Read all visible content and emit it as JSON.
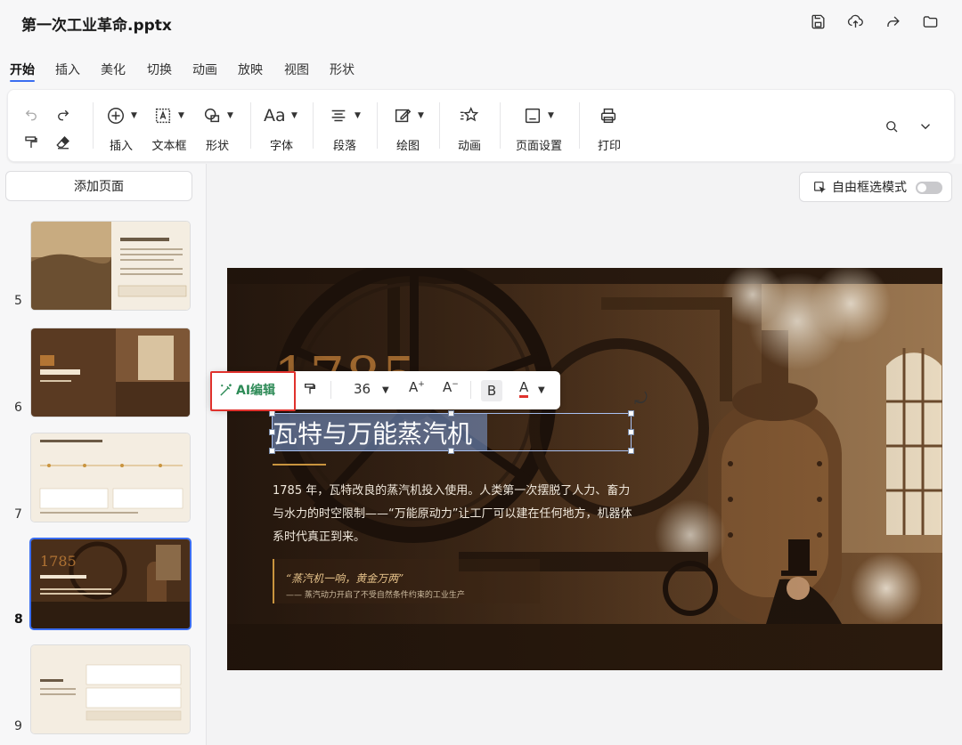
{
  "title_bar": {
    "doc_title": "第一次工业革命.pptx",
    "icons": [
      "save-icon",
      "upload-icon",
      "share-icon",
      "folder-icon"
    ]
  },
  "menu": {
    "tabs": [
      "开始",
      "插入",
      "美化",
      "切换",
      "动画",
      "放映",
      "视图",
      "形状"
    ],
    "active": "开始"
  },
  "ribbon": {
    "insert": "插入",
    "textbox": "文本框",
    "shape": "形状",
    "font": "字体",
    "paragraph": "段落",
    "draw": "绘图",
    "animation": "动画",
    "page_setup": "页面设置",
    "print": "打印"
  },
  "left_panel": {
    "add_page": "添加页面",
    "thumbnails": [
      {
        "num": "5",
        "selected": false
      },
      {
        "num": "6",
        "selected": false
      },
      {
        "num": "7",
        "selected": false
      },
      {
        "num": "8",
        "selected": true
      },
      {
        "num": "9",
        "selected": false
      }
    ]
  },
  "canvas": {
    "free_mode_label": "自由框选模式",
    "free_mode_on": false
  },
  "slide": {
    "year": "1785",
    "title": "瓦特与万能蒸汽机",
    "body": "1785 年，瓦特改良的蒸汽机投入使用。人类第一次摆脱了人力、畜力与水力的时空限制——“万能原动力”让工厂可以建在任何地方，机器体系时代真正到来。",
    "quote": "“蒸汽机一响，黄金万两”",
    "quote_sub": "—— 蒸汽动力开启了不受自然条件约束的工业生产"
  },
  "float_toolbar": {
    "ai_edit": "AI编辑",
    "font_size": "36",
    "bold": "B",
    "font_color_glyph": "A",
    "grow": "A",
    "shrink": "A"
  },
  "colors": {
    "accent_blue": "#3a6df0",
    "ai_green": "#2e8b57",
    "highlight_red": "#e0322d",
    "slide_gold": "#c9943e"
  }
}
